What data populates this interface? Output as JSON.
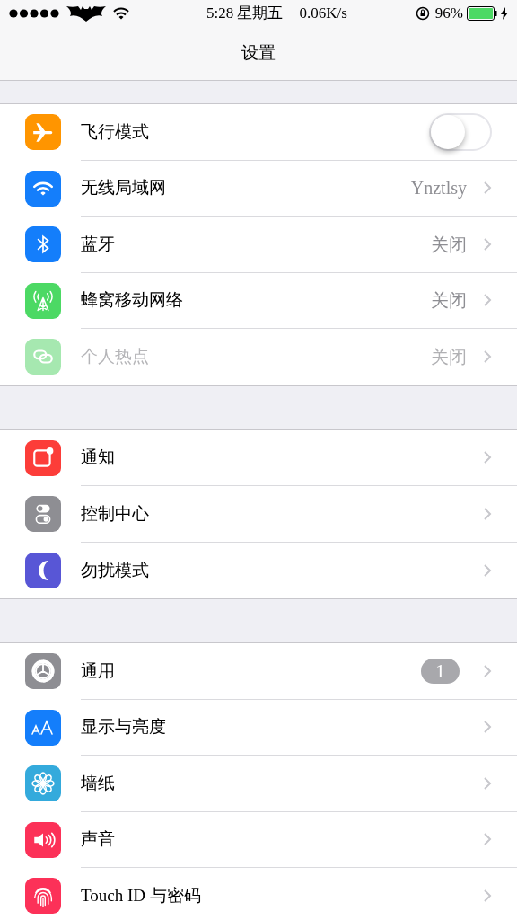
{
  "status_bar": {
    "time": "5:28 星期五",
    "speed": "0.06K/s",
    "battery_text": "96%"
  },
  "nav": {
    "title": "设置"
  },
  "sections": [
    {
      "rows": [
        {
          "kind": "toggle",
          "label": "飞行模式",
          "color": "#ff9500",
          "on": false,
          "disabled": false
        },
        {
          "kind": "value",
          "label": "无线局域网",
          "color": "#147efb",
          "value": "Ynztlsy",
          "disabled": false
        },
        {
          "kind": "value",
          "label": "蓝牙",
          "color": "#147efb",
          "value": "关闭",
          "disabled": false
        },
        {
          "kind": "value",
          "label": "蜂窝移动网络",
          "color": "#4cd964",
          "value": "关闭",
          "disabled": false
        },
        {
          "kind": "value",
          "label": "个人热点",
          "color": "#a6e8b0",
          "value": "关闭",
          "disabled": true
        }
      ]
    },
    {
      "rows": [
        {
          "kind": "link",
          "label": "通知",
          "color": "#fc3d39",
          "disabled": false
        },
        {
          "kind": "link",
          "label": "控制中心",
          "color": "#8e8e93",
          "disabled": false
        },
        {
          "kind": "link",
          "label": "勿扰模式",
          "color": "#5856d6",
          "disabled": false
        }
      ]
    },
    {
      "rows": [
        {
          "kind": "badge",
          "label": "通用",
          "color": "#8e8e93",
          "badge": "1",
          "disabled": false
        },
        {
          "kind": "link",
          "label": "显示与亮度",
          "color": "#147efb",
          "disabled": false
        },
        {
          "kind": "link",
          "label": "墙纸",
          "color": "#34aadc",
          "disabled": false
        },
        {
          "kind": "link",
          "label": "声音",
          "color": "#fc3158",
          "disabled": false
        },
        {
          "kind": "link",
          "label": "Touch ID 与密码",
          "color": "#fc3158",
          "disabled": false
        }
      ]
    }
  ]
}
